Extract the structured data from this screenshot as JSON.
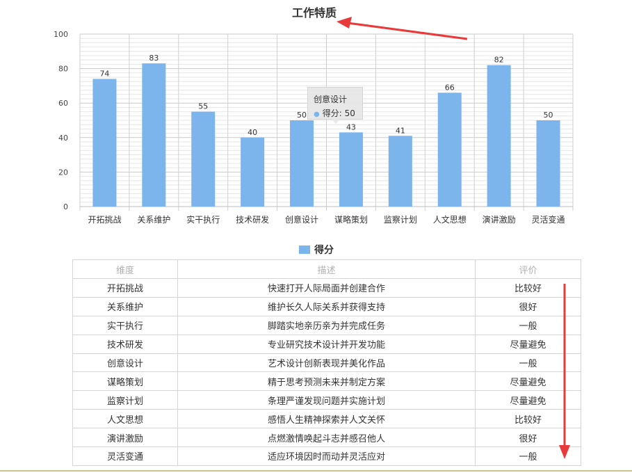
{
  "chart_data": {
    "type": "bar",
    "title": "工作特质",
    "categories": [
      "开拓挑战",
      "关系维护",
      "实干执行",
      "技术研发",
      "创意设计",
      "谋略策划",
      "监察计划",
      "人文思想",
      "演讲激励",
      "灵活变通"
    ],
    "series": [
      {
        "name": "得分",
        "values": [
          74,
          83,
          55,
          40,
          50,
          43,
          41,
          66,
          82,
          50
        ],
        "color": "#7cb5ec"
      }
    ],
    "ylim": [
      0,
      100
    ],
    "yticks": [
      0,
      20,
      40,
      60,
      80,
      100
    ],
    "grid": true,
    "legend": "bottom-center",
    "data_labels": true
  },
  "tooltip": {
    "category": "创意设计",
    "series": "得分",
    "value": "50"
  },
  "table": {
    "headers": [
      "维度",
      "描述",
      "评价"
    ],
    "rows": [
      [
        "开拓挑战",
        "快速打开人际局面并创建合作",
        "比较好"
      ],
      [
        "关系维护",
        "维护长久人际关系并获得支持",
        "很好"
      ],
      [
        "实干执行",
        "脚踏实地亲历亲为并完成任务",
        "一般"
      ],
      [
        "技术研发",
        "专业研究技术设计并开发功能",
        "尽量避免"
      ],
      [
        "创意设计",
        "艺术设计创新表现并美化作品",
        "一般"
      ],
      [
        "谋略策划",
        "精于思考预测未来并制定方案",
        "尽量避免"
      ],
      [
        "监察计划",
        "条理严谨发现问题并实施计划",
        "尽量避免"
      ],
      [
        "人文思想",
        "感悟人生精神探索并人文关怀",
        "比较好"
      ],
      [
        "演讲激励",
        "点燃激情唤起斗志并感召他人",
        "很好"
      ],
      [
        "灵活变通",
        "适应环境因时而动并灵活应对",
        "一般"
      ]
    ]
  },
  "colors": {
    "bar": "#7cb5ec",
    "annotation_arrow": "#e83a3a"
  }
}
